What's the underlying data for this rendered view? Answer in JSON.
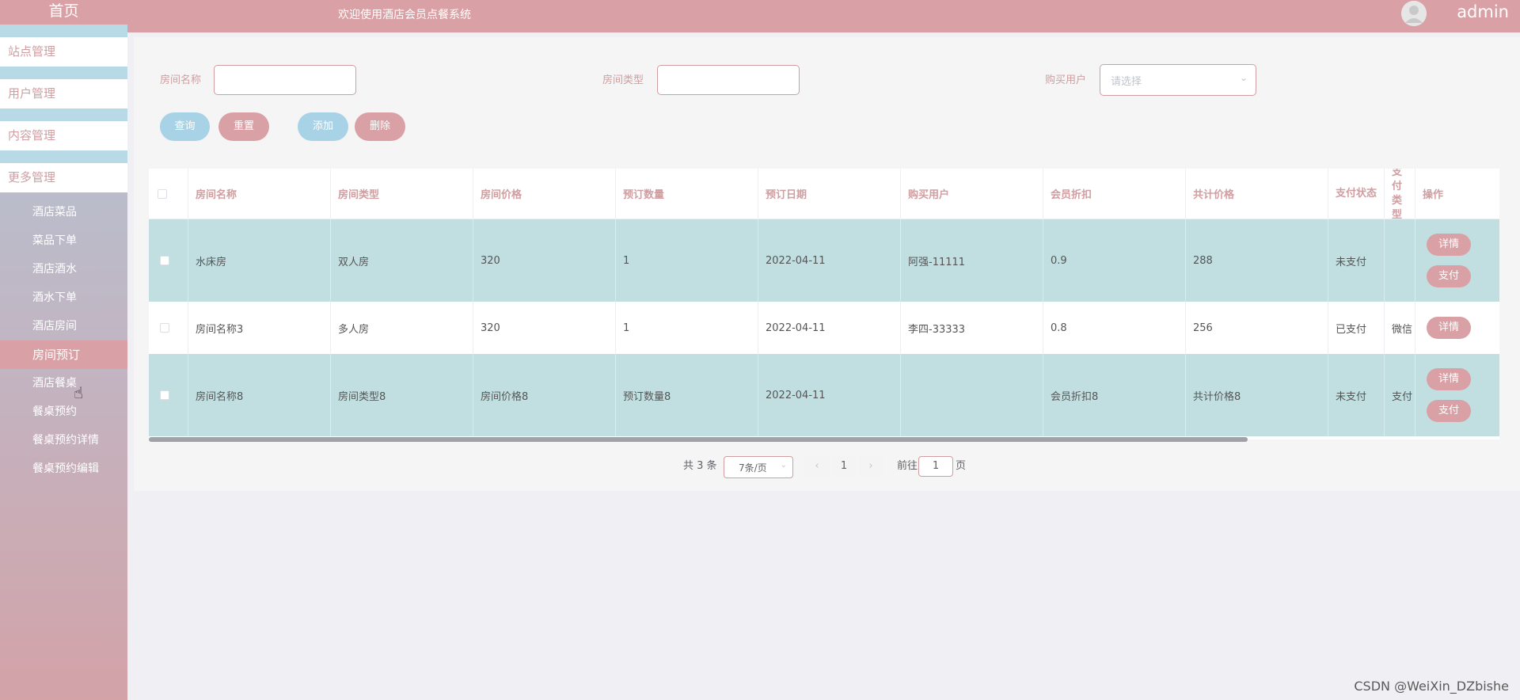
{
  "sidebar": {
    "brand": "首页",
    "menus": [
      {
        "label": "站点管理"
      },
      {
        "label": "用户管理"
      },
      {
        "label": "内容管理"
      },
      {
        "label": "更多管理"
      }
    ],
    "submenu": [
      {
        "label": "酒店菜品",
        "active": false
      },
      {
        "label": "菜品下单",
        "active": false
      },
      {
        "label": "酒店酒水",
        "active": false
      },
      {
        "label": "酒水下单",
        "active": false
      },
      {
        "label": "酒店房间",
        "active": false
      },
      {
        "label": "房间预订",
        "active": true
      },
      {
        "label": "酒店餐桌",
        "active": false
      },
      {
        "label": "餐桌预约",
        "active": false
      },
      {
        "label": "餐桌预约详情",
        "active": false
      },
      {
        "label": "餐桌预约编辑",
        "active": false
      }
    ]
  },
  "header": {
    "welcome": "欢迎使用酒店会员点餐系统",
    "user": "admin"
  },
  "search": {
    "room_name_label": "房间名称",
    "room_name_value": "",
    "room_type_label": "房间类型",
    "room_type_value": "",
    "buyer_label": "购买用户",
    "buyer_placeholder": "请选择"
  },
  "buttons": {
    "query": "查询",
    "reset": "重置",
    "add": "添加",
    "delete": "删除"
  },
  "table": {
    "headers": [
      "房间名称",
      "房间类型",
      "房间价格",
      "预订数量",
      "预订日期",
      "购买用户",
      "会员折扣",
      "共计价格",
      "支付状态",
      "支付类型",
      "操作"
    ],
    "rows": [
      {
        "name": "水床房",
        "type": "双人房",
        "price": "320",
        "qty": "1",
        "date": "2022-04-11",
        "buyer": "阿强-11111",
        "discount": "0.9",
        "total": "288",
        "status": "未支付",
        "paytype": "",
        "ops": [
          "详情",
          "支付"
        ]
      },
      {
        "name": "房间名称3",
        "type": "多人房",
        "price": "320",
        "qty": "1",
        "date": "2022-04-11",
        "buyer": "李四-33333",
        "discount": "0.8",
        "total": "256",
        "status": "已支付",
        "paytype": "微信",
        "ops": [
          "详情"
        ]
      },
      {
        "name": "房间名称8",
        "type": "房间类型8",
        "price": "房间价格8",
        "qty": "预订数量8",
        "date": "2022-04-11",
        "buyer": "",
        "discount": "会员折扣8",
        "total": "共计价格8",
        "status": "未支付",
        "paytype": "支付",
        "ops": [
          "详情",
          "支付"
        ]
      }
    ]
  },
  "pagination": {
    "total": "共 3 条",
    "page_size": "7条/页",
    "prev": "‹",
    "current": "1",
    "next": "›",
    "goto_label": "前往",
    "goto_value": "1",
    "goto_suffix": "页"
  },
  "watermark": "CSDN @WeiXin_DZbishe",
  "colors": {
    "primary_pink": "#d9a1a5",
    "accent_blue": "#a8d2e6",
    "row_highlight": "#c1dfe1"
  }
}
